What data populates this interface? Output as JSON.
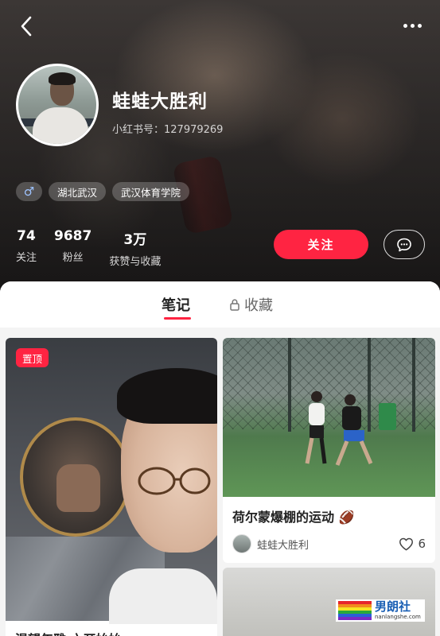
{
  "profile": {
    "username": "蛙蛙大胜利",
    "redid": "小红书号：127979269",
    "tags": [
      "湖北武汉",
      "武汉体育学院"
    ],
    "gender_symbol": "♂",
    "stats": [
      {
        "value": "74",
        "label": "关注"
      },
      {
        "value": "9687",
        "label": "粉丝"
      },
      {
        "value": "3万",
        "label": "获赞与收藏"
      }
    ],
    "follow_label": "关注"
  },
  "tabs": [
    {
      "label": "笔记",
      "active": true
    },
    {
      "label": "收藏",
      "active": false
    }
  ],
  "notes": [
    {
      "title": "渴望年雅 六开始始",
      "pinned_label": "置顶"
    },
    {
      "title": "荷尔蒙爆棚的运动 🏈",
      "author": "蛙蛙大胜利",
      "likes": "6"
    }
  ],
  "watermark": {
    "text": "男朗社",
    "url": "nanlangshe.com"
  },
  "colors": {
    "accent": "#ff2442",
    "header_bg": "#3a3533"
  },
  "icons": [
    "back-arrow-icon",
    "more-dots-icon",
    "message-icon",
    "lock-icon",
    "heart-icon",
    "male-icon"
  ]
}
